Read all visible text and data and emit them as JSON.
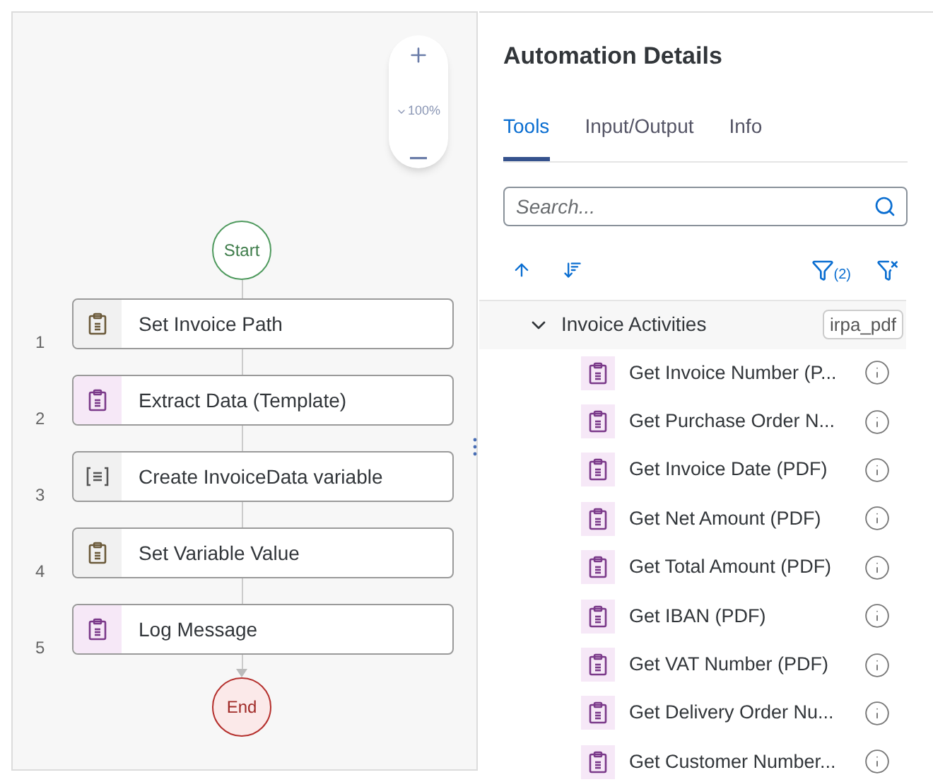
{
  "canvas": {
    "zoom": {
      "level_text": "100%"
    },
    "start": "Start",
    "end": "End",
    "steps": [
      {
        "number": "1",
        "label": "Set Invoice Path",
        "kind": "core"
      },
      {
        "number": "2",
        "label": "Extract Data (Template)",
        "kind": "pdf"
      },
      {
        "number": "3",
        "label": "Create InvoiceData variable",
        "kind": "variable"
      },
      {
        "number": "4",
        "label": "Set Variable Value",
        "kind": "core"
      },
      {
        "number": "5",
        "label": "Log Message",
        "kind": "pdf"
      }
    ]
  },
  "panel": {
    "title": "Automation Details",
    "tabs": [
      {
        "label": "Tools",
        "selected": true
      },
      {
        "label": "Input/Output",
        "selected": false
      },
      {
        "label": "Info",
        "selected": false
      }
    ],
    "search": {
      "placeholder": "Search..."
    },
    "filter_count": "(2)",
    "group": {
      "label": "Invoice Activities",
      "tag": "irpa_pdf",
      "expanded": true,
      "items": [
        {
          "label": "Get Invoice Number (P..."
        },
        {
          "label": "Get Purchase Order N..."
        },
        {
          "label": "Get Invoice Date (PDF)"
        },
        {
          "label": "Get Net Amount (PDF)"
        },
        {
          "label": "Get Total Amount (PDF)"
        },
        {
          "label": "Get IBAN (PDF)"
        },
        {
          "label": "Get VAT Number (PDF)"
        },
        {
          "label": "Get Delivery Order Nu..."
        },
        {
          "label": "Get Customer Number..."
        }
      ]
    }
  }
}
